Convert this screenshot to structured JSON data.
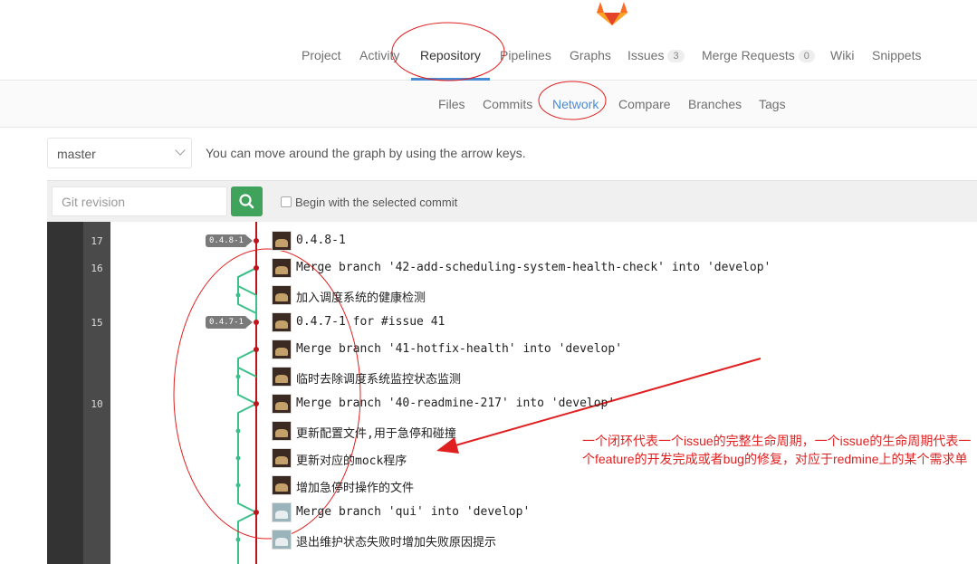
{
  "nav": {
    "items": [
      {
        "label": "Project"
      },
      {
        "label": "Activity"
      },
      {
        "label": "Repository"
      },
      {
        "label": "Pipelines"
      },
      {
        "label": "Graphs"
      },
      {
        "label": "Issues",
        "count": "3"
      },
      {
        "label": "Merge Requests",
        "count": "0"
      },
      {
        "label": "Wiki"
      },
      {
        "label": "Snippets"
      }
    ],
    "active": "Repository"
  },
  "subnav": {
    "items": [
      {
        "label": "Files"
      },
      {
        "label": "Commits"
      },
      {
        "label": "Network"
      },
      {
        "label": "Compare"
      },
      {
        "label": "Branches"
      },
      {
        "label": "Tags"
      }
    ],
    "active": "Network"
  },
  "branch_select": {
    "value": "master"
  },
  "hint": "You can move around the graph by using the arrow keys.",
  "revision": {
    "placeholder": "Git revision",
    "checkbox_label": "Begin with the selected commit",
    "checked": false
  },
  "graph": {
    "day_numbers": [
      "17",
      "16",
      "15",
      "10"
    ],
    "tags": [
      "0.4.8-1",
      "0.4.7-1"
    ],
    "commits": [
      {
        "message": "0.4.8-1"
      },
      {
        "message": "Merge branch '42-add-scheduling-system-health-check' into 'develop'"
      },
      {
        "message": "加入调度系统的健康检测"
      },
      {
        "message": "0.4.7-1 for #issue 41"
      },
      {
        "message": "Merge branch '41-hotfix-health' into 'develop'"
      },
      {
        "message": "临时去除调度系统监控状态监测"
      },
      {
        "message": "Merge branch '40-readmine-217' into 'develop'"
      },
      {
        "message": "更新配置文件,用于急停和碰撞"
      },
      {
        "message": "更新对应的mock程序"
      },
      {
        "message": "增加急停时操作的文件"
      },
      {
        "message": "Merge branch 'qui' into 'develop'"
      },
      {
        "message": "退出维护状态失败时增加失败原因提示"
      }
    ]
  },
  "annotation": {
    "text": "一个闭环代表一个issue的完整生命周期，一个issue的生命周期代表一个feature的开发完成或者bug的修复，对应于redmine上的某个需求单"
  },
  "colors": {
    "accent": "#4a8bd6",
    "search": "#3fa35b",
    "master_line": "#c0141d",
    "branch_line": "#3cc08a",
    "annotation": "#e02020"
  }
}
